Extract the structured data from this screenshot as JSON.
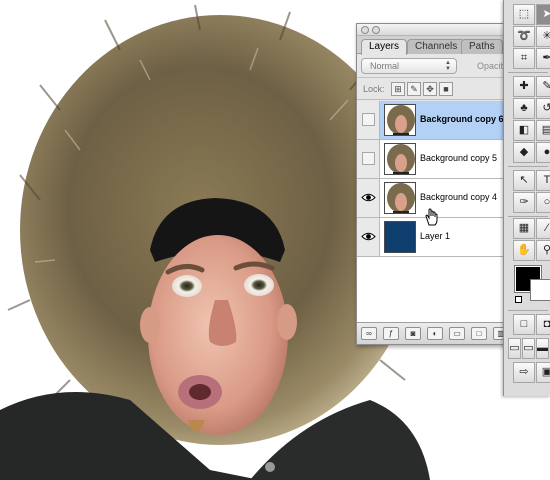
{
  "layers_palette": {
    "tabs": [
      {
        "label": "Layers",
        "active": true
      },
      {
        "label": "Channels",
        "active": false
      },
      {
        "label": "Paths",
        "active": false
      }
    ],
    "blend_mode": "Normal",
    "opacity_label": "Opacit",
    "lock_label": "Lock:",
    "layers": [
      {
        "name": "Background copy 6",
        "visible": false,
        "selected": true,
        "thumbnail": "photo"
      },
      {
        "name": "Background copy 5",
        "visible": false,
        "selected": false,
        "thumbnail": "photo"
      },
      {
        "name": "Background copy 4",
        "visible": true,
        "selected": false,
        "thumbnail": "photo"
      },
      {
        "name": "Layer 1",
        "visible": true,
        "selected": false,
        "thumbnail": "solid"
      }
    ],
    "layer1_fill_color": "#0e3f6e",
    "selection_color": "#b3d1f5"
  },
  "tools_palette": {
    "tools": [
      "marquee-icon",
      "move-icon",
      "lasso-icon",
      "magic-wand-icon",
      "crop-icon",
      "slice-icon",
      "healing-brush-icon",
      "brush-icon",
      "stamp-icon",
      "history-brush-icon",
      "eraser-icon",
      "gradient-icon",
      "blur-icon",
      "dodge-icon",
      "path-select-icon",
      "type-icon",
      "pen-icon",
      "shape-icon",
      "notes-icon",
      "eyedropper-icon",
      "hand-icon",
      "zoom-icon"
    ],
    "foreground_color": "#000000",
    "background_color": "#ffffff"
  },
  "canvas": {
    "subject": "photo-man-in-fur-hood"
  }
}
